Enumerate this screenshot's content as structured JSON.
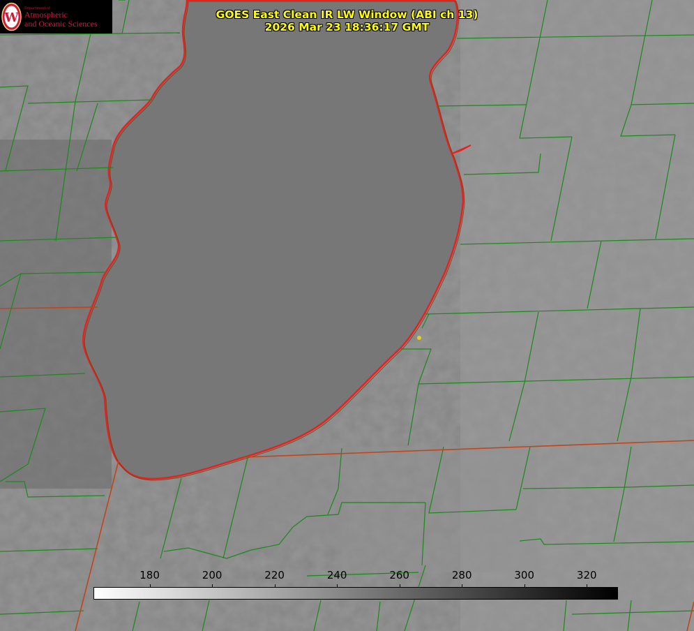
{
  "title": {
    "line1": "GOES East Clean IR LW Window (ABI ch 13)",
    "line2": "2026 Mar 23 18:36:17 GMT"
  },
  "logo": {
    "department": "Department of",
    "line1": "Atmospheric",
    "line2": "and Oceanic Sciences",
    "accent": "#c81e3a"
  },
  "colorbar": {
    "min": 162,
    "max": 330,
    "ticks": [
      "180",
      "200",
      "220",
      "240",
      "260",
      "280",
      "300",
      "320"
    ],
    "tick_values": [
      180,
      200,
      220,
      240,
      260,
      280,
      300,
      320
    ],
    "colors": [
      "#ffffff",
      "#000000"
    ]
  },
  "map_colors": {
    "lake_shoreline": "#e82020",
    "county_lines": "#1a8a1a",
    "state_lines": "#c0451a",
    "marker": "#e0d020"
  }
}
